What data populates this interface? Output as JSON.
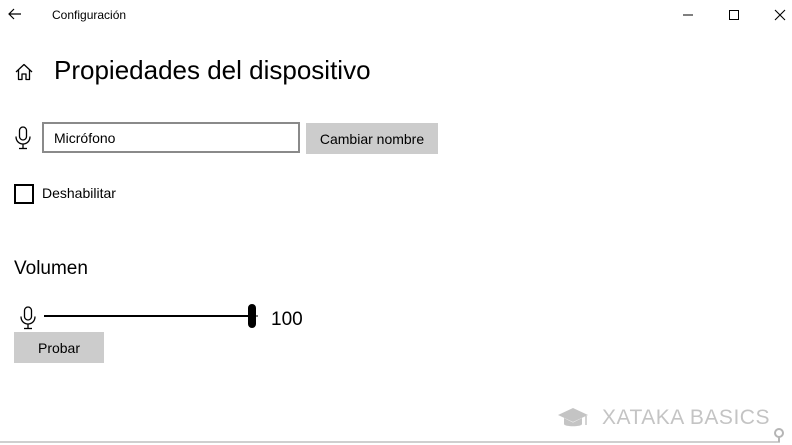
{
  "window": {
    "title": "Configuración",
    "icons": {
      "back": "back-arrow-icon",
      "minimize": "minimize-icon",
      "maximize": "maximize-icon",
      "close": "close-icon"
    }
  },
  "header": {
    "title": "Propiedades del dispositivo",
    "home_icon": "home-icon"
  },
  "device": {
    "icon": "microphone-icon",
    "name_value": "Micrófono",
    "rename_label": "Cambiar nombre",
    "disable_label": "Deshabilitar",
    "disable_checked": false
  },
  "volume": {
    "title": "Volumen",
    "icon": "microphone-icon",
    "value": 100,
    "value_label": "100",
    "min": 0,
    "max": 100,
    "test_label": "Probar"
  },
  "watermark": {
    "text": "XATAKA BASICS",
    "icon": "graduation-cap-icon"
  },
  "colors": {
    "button_bg": "#cccccc",
    "input_border": "#8a8a8a",
    "watermark": "#c4c4c4"
  }
}
